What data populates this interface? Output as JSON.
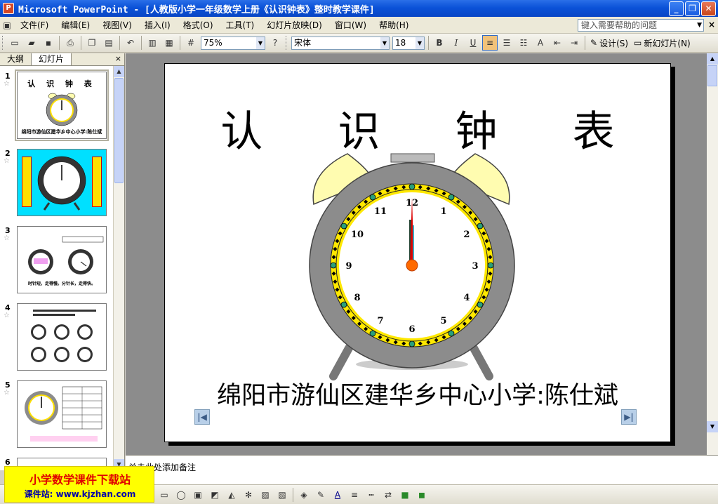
{
  "window": {
    "title": "Microsoft PowerPoint - [人教版小学一年级数学上册《认识钟表》整时教学课件]",
    "app_icon": "P",
    "controls": [
      "_",
      "❐",
      "✕"
    ]
  },
  "menu": {
    "items": [
      "文件(F)",
      "编辑(E)",
      "视图(V)",
      "插入(I)",
      "格式(O)",
      "工具(T)",
      "幻灯片放映(D)",
      "窗口(W)",
      "帮助(H)"
    ],
    "help_placeholder": "键入需要帮助的问题",
    "close": "×"
  },
  "toolbar": {
    "zoom": "75%",
    "font": "宋体",
    "font_size": "18",
    "bold": "B",
    "italic": "I",
    "underline": "U",
    "design_label": "设计(S)",
    "new_slide_label": "新幻灯片(N)"
  },
  "left_pane": {
    "tabs": [
      "大纲",
      "幻灯片"
    ],
    "active_tab": 1,
    "close": "×",
    "slides": [
      {
        "number": "1",
        "title": "认 识 钟 表",
        "caption": "绵阳市游仙区建华乡中心小学:陈仕斌"
      },
      {
        "number": "2"
      },
      {
        "number": "3",
        "caption": "时针短，走得慢。分针长，走得快。"
      },
      {
        "number": "4"
      },
      {
        "number": "5"
      },
      {
        "number": "6"
      }
    ]
  },
  "slide": {
    "title": "认 识 钟 表",
    "subtitle": "绵阳市游仙区建华乡中心小学:陈仕斌",
    "clock_numbers": [
      "12",
      "1",
      "2",
      "3",
      "4",
      "5",
      "6",
      "7",
      "8",
      "9",
      "10",
      "11"
    ],
    "prev_icon": "|◀",
    "next_icon": "▶|"
  },
  "notes": {
    "text": "单击此处添加备注"
  },
  "badge": {
    "line1": "小学数学课件下载站",
    "line2": "课件站: www.kjzhan.com"
  },
  "colors": {
    "titlebar": "#0b52d8",
    "slide_thumb2_bg": "#00e0ff",
    "clock_body": "#8c8c8c",
    "clock_bells": "#fffcb0",
    "badge_bg": "#ffff00"
  }
}
